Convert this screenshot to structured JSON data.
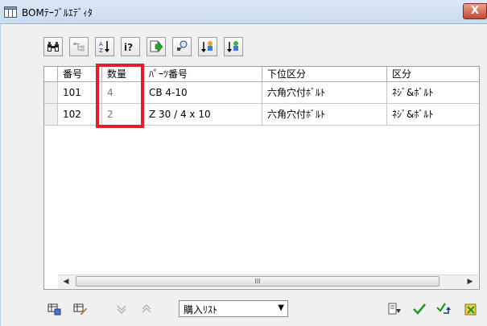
{
  "window": {
    "title": "BOMﾃｰﾌﾞﾙｴﾃﾞｨﾀ",
    "close_label": "X"
  },
  "toolbar": {
    "buttons": [
      {
        "icon": "binoculars-icon"
      },
      {
        "icon": "tree-expand-icon"
      },
      {
        "icon": "sort-az-icon"
      },
      {
        "icon": "help-icon"
      },
      {
        "icon": "export-icon"
      },
      {
        "icon": "link-icon"
      },
      {
        "icon": "move-up-icon"
      },
      {
        "icon": "move-down-icon"
      }
    ]
  },
  "grid": {
    "columns": [
      "番号",
      "数量",
      "ﾊﾟｰﾂ番号",
      "下位区分",
      "区分"
    ],
    "rows": [
      {
        "no": "101",
        "qty": "4",
        "part": "CB 4-10",
        "subcategory": "六角穴付ﾎﾞﾙﾄ",
        "category": "ﾈｼﾞ&ﾎﾞﾙﾄ"
      },
      {
        "no": "102",
        "qty": "2",
        "part": "Z 30 / 4 x 10",
        "subcategory": "六角穴付ﾎﾞﾙﾄ",
        "category": "ﾈｼﾞ&ﾎﾞﾙﾄ"
      }
    ],
    "scroll_thumb_label": "III"
  },
  "bottom": {
    "list_select": "購入ﾘｽﾄ"
  },
  "colors": {
    "highlight": "#e8192c",
    "accept": "#1e9a1e"
  }
}
